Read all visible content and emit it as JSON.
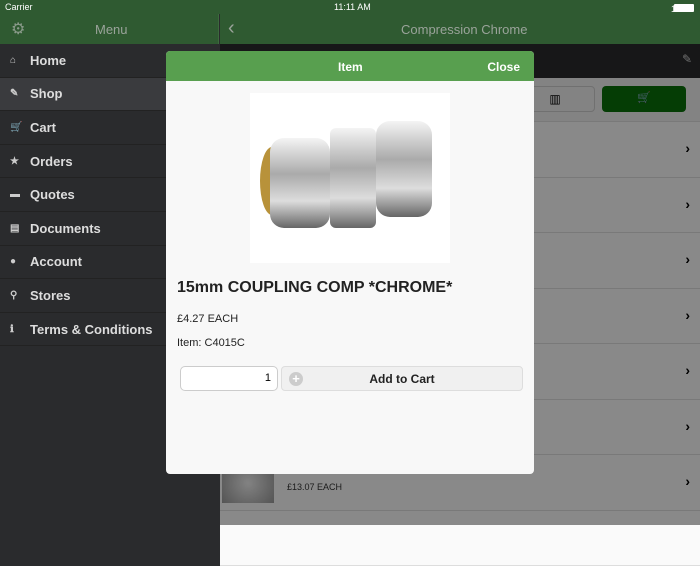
{
  "status": {
    "carrier": "Carrier",
    "time": "11:11 AM",
    "battery": "100%"
  },
  "nav": {
    "menu_title": "Menu",
    "page_title": "Compression Chrome"
  },
  "sidebar": {
    "items": [
      {
        "label": "Home",
        "icon": "⌂"
      },
      {
        "label": "Shop",
        "icon": "✎"
      },
      {
        "label": "Cart",
        "icon": "🛒"
      },
      {
        "label": "Orders",
        "icon": "★"
      },
      {
        "label": "Quotes",
        "icon": "▬"
      },
      {
        "label": "Documents",
        "icon": "▤"
      },
      {
        "label": "Account",
        "icon": "●"
      },
      {
        "label": "Stores",
        "icon": "⚲"
      },
      {
        "label": "Terms & Conditions",
        "icon": "ℹ"
      }
    ]
  },
  "list": {
    "visible_price": "£13.07 EACH"
  },
  "modal": {
    "title": "Item",
    "close": "Close",
    "product_name": "15mm COUPLING COMP *CHROME*",
    "price": "£4.27 EACH",
    "item_code": "Item: C4015C",
    "quantity": "1",
    "add_to_cart": "Add to Cart"
  }
}
